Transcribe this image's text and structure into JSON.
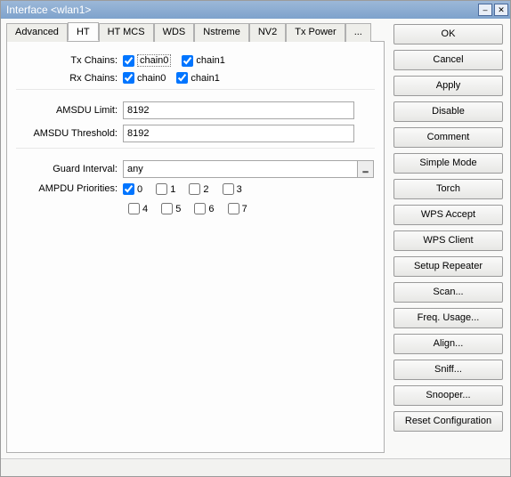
{
  "window": {
    "title": "Interface <wlan1>"
  },
  "tabs": {
    "items": [
      "Advanced",
      "HT",
      "HT MCS",
      "WDS",
      "Nstreme",
      "NV2",
      "Tx Power",
      "..."
    ],
    "active_index": 1
  },
  "form": {
    "tx_chains": {
      "label": "Tx Chains:",
      "chain0": "chain0",
      "chain1": "chain1",
      "ck0": true,
      "ck1": true
    },
    "rx_chains": {
      "label": "Rx Chains:",
      "chain0": "chain0",
      "chain1": "chain1",
      "ck0": true,
      "ck1": true
    },
    "amsdu_limit": {
      "label": "AMSDU Limit:",
      "value": "8192"
    },
    "amsdu_threshold": {
      "label": "AMSDU Threshold:",
      "value": "8192"
    },
    "guard_interval": {
      "label": "Guard Interval:",
      "value": "any"
    },
    "ampdu_priorities": {
      "label": "AMPDU Priorities:",
      "opts": [
        "0",
        "1",
        "2",
        "3",
        "4",
        "5",
        "6",
        "7"
      ],
      "checked": [
        true,
        false,
        false,
        false,
        false,
        false,
        false,
        false
      ]
    }
  },
  "buttons": {
    "ok": "OK",
    "cancel": "Cancel",
    "apply": "Apply",
    "disable": "Disable",
    "comment": "Comment",
    "simple_mode": "Simple Mode",
    "torch": "Torch",
    "wps_accept": "WPS Accept",
    "wps_client": "WPS Client",
    "setup_repeater": "Setup Repeater",
    "scan": "Scan...",
    "freq_usage": "Freq. Usage...",
    "align": "Align...",
    "sniff": "Sniff...",
    "snooper": "Snooper...",
    "reset_config": "Reset Configuration"
  }
}
